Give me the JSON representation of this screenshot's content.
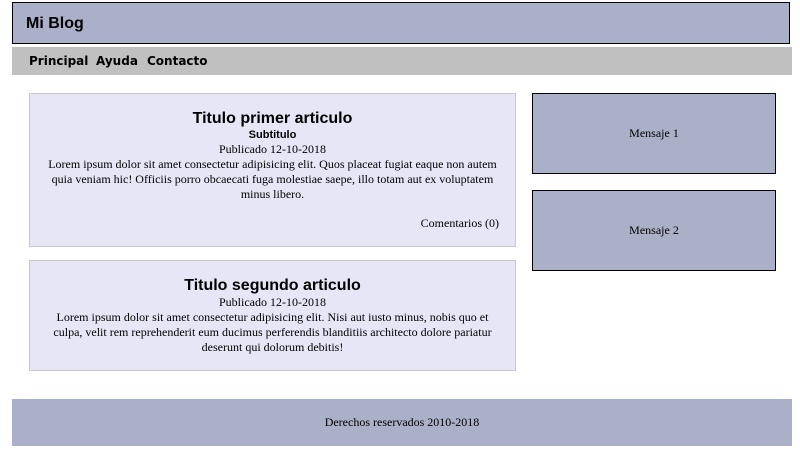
{
  "header": {
    "title": "Mi Blog"
  },
  "nav": {
    "items": [
      {
        "label": "Principal"
      },
      {
        "label": "Ayuda"
      },
      {
        "label": "Contacto"
      }
    ]
  },
  "articles": [
    {
      "title": "Titulo primer articulo",
      "subtitle": "Subtitulo",
      "date": "Publicado 12-10-2018",
      "body": "Lorem ipsum dolor sit amet consectetur adipisicing elit. Quos placeat fugiat eaque non autem quia veniam hic! Officiis porro obcaecati fuga molestiae saepe, illo totam aut ex voluptatem minus libero.",
      "comments": "Comentarios (0)"
    },
    {
      "title": "Titulo segundo articulo",
      "date": "Publicado 12-10-2018",
      "body": "Lorem ipsum dolor sit amet consectetur adipisicing elit. Nisi aut iusto minus, nobis quo et culpa, velit rem reprehenderit eum ducimus perferendis blanditiis architecto dolore pariatur deserunt qui dolorum debitis!"
    }
  ],
  "sidebar": {
    "messages": [
      {
        "label": "Mensaje 1"
      },
      {
        "label": "Mensaje 2"
      }
    ]
  },
  "footer": {
    "text": "Derechos reservados 2010-2018"
  },
  "colors": {
    "header_bg": "#abb0c9",
    "nav_bg": "#c0c0c0",
    "article_bg": "#e6e6f7"
  }
}
